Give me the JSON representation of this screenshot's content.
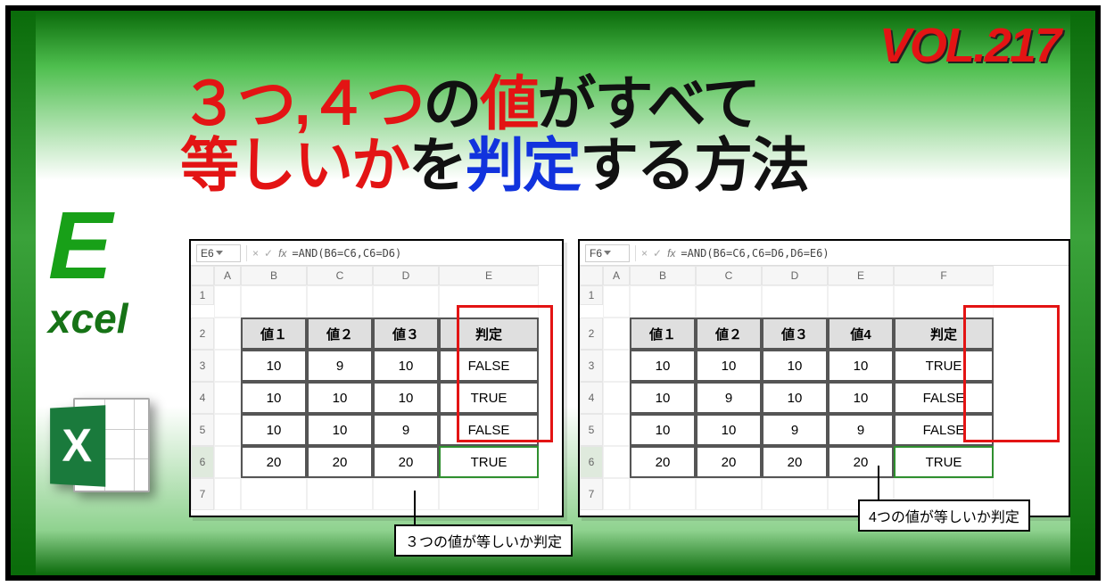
{
  "volume": "VOL.217",
  "title_parts": {
    "a": "３つ",
    "comma": ",",
    "b": "４つ",
    "c": "の",
    "d": "値",
    "e": "がすべて",
    "f": "等しいか",
    "g": "を",
    "h": "判定",
    "i": "する方法"
  },
  "logo": {
    "big": "E",
    "rest": "xcel",
    "icon_letter": "X"
  },
  "fx_label": "fx",
  "shot1": {
    "nameBox": "E6",
    "formula": "=AND(B6=C6,C6=D6)",
    "cols": [
      "",
      "A",
      "B",
      "C",
      "D",
      "E"
    ],
    "rows": [
      "1",
      "2",
      "3",
      "4",
      "5",
      "6",
      "7"
    ],
    "headers": [
      "値１",
      "値２",
      "値３",
      "判定"
    ],
    "data": [
      [
        "10",
        "9",
        "10",
        "FALSE"
      ],
      [
        "10",
        "10",
        "10",
        "TRUE"
      ],
      [
        "10",
        "10",
        "9",
        "FALSE"
      ],
      [
        "20",
        "20",
        "20",
        "TRUE"
      ]
    ],
    "callout": "３つの値が等しいか判定"
  },
  "shot2": {
    "nameBox": "F6",
    "formula": "=AND(B6=C6,C6=D6,D6=E6)",
    "cols": [
      "",
      "A",
      "B",
      "C",
      "D",
      "E",
      "F"
    ],
    "rows": [
      "1",
      "2",
      "3",
      "4",
      "5",
      "6",
      "7"
    ],
    "headers": [
      "値１",
      "値２",
      "値３",
      "値4",
      "判定"
    ],
    "data": [
      [
        "10",
        "10",
        "10",
        "10",
        "TRUE"
      ],
      [
        "10",
        "9",
        "10",
        "10",
        "FALSE"
      ],
      [
        "10",
        "10",
        "9",
        "9",
        "FALSE"
      ],
      [
        "20",
        "20",
        "20",
        "20",
        "TRUE"
      ]
    ],
    "callout": "4つの値が等しいか判定"
  },
  "chart_data": [
    {
      "type": "table",
      "title": "３つの値が等しいか判定",
      "formula": "=AND(B6=C6,C6=D6)",
      "columns": [
        "値１",
        "値２",
        "値３",
        "判定"
      ],
      "rows": [
        [
          10,
          9,
          10,
          "FALSE"
        ],
        [
          10,
          10,
          10,
          "TRUE"
        ],
        [
          10,
          10,
          9,
          "FALSE"
        ],
        [
          20,
          20,
          20,
          "TRUE"
        ]
      ]
    },
    {
      "type": "table",
      "title": "4つの値が等しいか判定",
      "formula": "=AND(B6=C6,C6=D6,D6=E6)",
      "columns": [
        "値１",
        "値２",
        "値３",
        "値4",
        "判定"
      ],
      "rows": [
        [
          10,
          10,
          10,
          10,
          "TRUE"
        ],
        [
          10,
          9,
          10,
          10,
          "FALSE"
        ],
        [
          10,
          10,
          9,
          9,
          "FALSE"
        ],
        [
          20,
          20,
          20,
          20,
          "TRUE"
        ]
      ]
    }
  ]
}
